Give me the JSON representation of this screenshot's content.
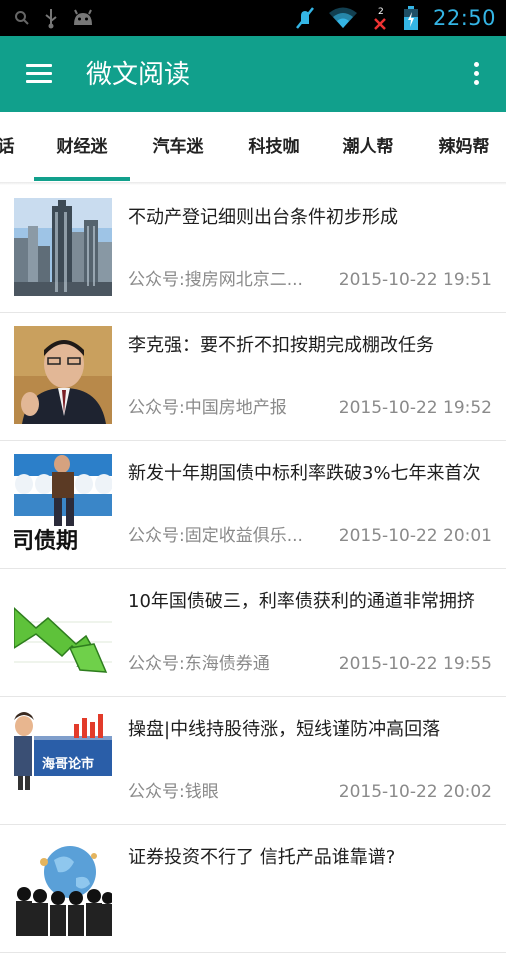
{
  "status_bar": {
    "time": "22:50",
    "icons": [
      "search-icon",
      "usb-icon",
      "android-icon",
      "silent-icon",
      "wifi-icon",
      "no-signal-icon",
      "battery-charging-icon"
    ],
    "notification_count": "2",
    "accent_color": "#34b5e5"
  },
  "app_bar": {
    "title": "微文阅读",
    "background_color": "#11a08c"
  },
  "tabs": [
    {
      "label": "话"
    },
    {
      "label": "财经迷",
      "selected": true
    },
    {
      "label": "汽车迷"
    },
    {
      "label": "科技咖"
    },
    {
      "label": "潮人帮"
    },
    {
      "label": "辣妈帮"
    }
  ],
  "articles": [
    {
      "title": "不动产登记细则出台条件初步形成",
      "source": "公众号:搜房网北京二...",
      "time": "2015-10-22 19:51",
      "thumb": "city-skyline"
    },
    {
      "title": "李克强：要不折不扣按期完成棚改任务",
      "source": "公众号:中国房地产报",
      "time": "2015-10-22 19:52",
      "thumb": "portrait"
    },
    {
      "title": "新发十年期国债中标利率跌破3%七年来首次",
      "source": "公众号:固定收益俱乐...",
      "time": "2015-10-22 20:01",
      "thumb": "bond-board",
      "thumb_text": "司债期"
    },
    {
      "title": "10年国债破三，利率债获利的通道非常拥挤",
      "source": "公众号:东海债券通",
      "time": "2015-10-22 19:55",
      "thumb": "down-arrow"
    },
    {
      "title": "操盘|中线持股待涨，短线谨防冲高回落",
      "source": "公众号:钱眼",
      "time": "2015-10-22 20:02",
      "thumb": "market-board",
      "thumb_text": "海哥论市"
    },
    {
      "title": "证券投资不行了 信托产品谁靠谱?",
      "source": "",
      "time": "",
      "thumb": "globe-crowd"
    }
  ]
}
